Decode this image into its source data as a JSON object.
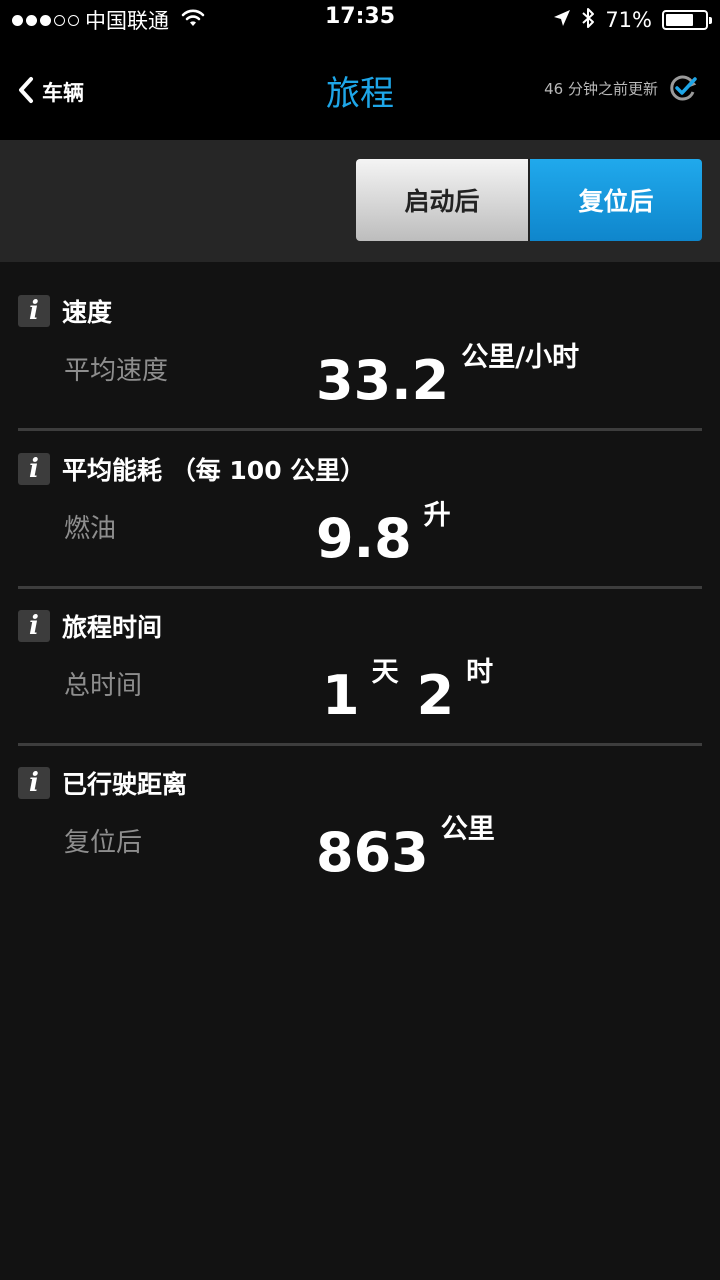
{
  "status_bar": {
    "carrier": "中国联通",
    "time": "17:35",
    "battery": "71%",
    "battery_level": 0.71,
    "signal_dots_filled": 3,
    "signal_dots_total": 5
  },
  "nav": {
    "back_label": "车辆",
    "title": "旅程",
    "updated_text": "46 分钟之前更新"
  },
  "segment": {
    "option1": "启动后",
    "option2": "复位后",
    "selected": "复位后"
  },
  "sections": {
    "speed": {
      "title": "速度",
      "label": "平均速度",
      "value": "33.2",
      "unit": "公里/小时"
    },
    "consumption": {
      "title": "平均能耗 （每 100 公里）",
      "label": "燃油",
      "value": "9.8",
      "unit": "升"
    },
    "trip_time": {
      "title": "旅程时间",
      "label": "总时间",
      "days": "1",
      "days_unit": "天",
      "hours": "2",
      "hours_unit": "时"
    },
    "distance": {
      "title": "已行驶距离",
      "label": "复位后",
      "value": "863",
      "unit": "公里"
    }
  },
  "colors": {
    "accent": "#1ea6e8",
    "background": "#121212",
    "bar_background": "#000000"
  },
  "icons": [
    "back-chevron-icon",
    "wifi-icon",
    "location-arrow-icon",
    "bluetooth-icon",
    "battery-icon",
    "refresh-check-icon",
    "info-icon"
  ]
}
